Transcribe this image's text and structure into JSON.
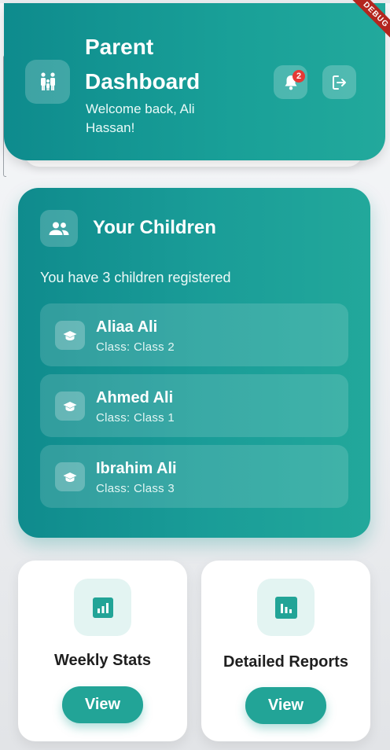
{
  "header": {
    "title": "Parent Dashboard",
    "welcome": "Welcome back, Ali Hassan!",
    "notification_count": "2",
    "debug_ribbon": "DEBUG",
    "icons": {
      "family": "family-icon",
      "notification": "bell-icon",
      "logout": "logout-icon"
    }
  },
  "children": {
    "title": "Your Children",
    "summary": "You have 3 children registered",
    "icon": "people-icon",
    "items": [
      {
        "name": "Aliaa Ali",
        "class": "Class: Class 2",
        "icon": "graduation-cap-icon"
      },
      {
        "name": "Ahmed Ali",
        "class": "Class: Class 1",
        "icon": "graduation-cap-icon"
      },
      {
        "name": "Ibrahim Ali",
        "class": "Class: Class 3",
        "icon": "graduation-cap-icon"
      }
    ]
  },
  "cards": [
    {
      "label": "Weekly Stats",
      "button": "View",
      "icon": "stats-chart-icon"
    },
    {
      "label": "Detailed Reports",
      "button": "View",
      "icon": "bar-chart-icon"
    }
  ],
  "colors": {
    "primary_teal": "#1a9d98",
    "accent_button": "#22a497",
    "badge_red": "#e53935",
    "icon_tile_bg": "#e3f4f2"
  }
}
